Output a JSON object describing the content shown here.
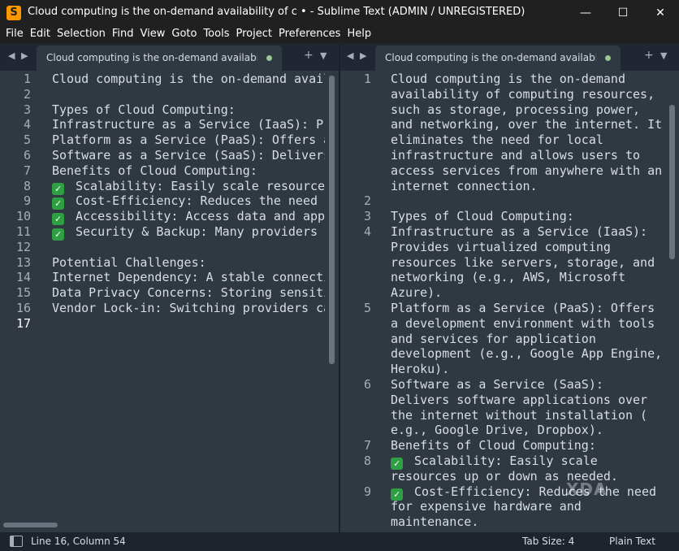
{
  "window": {
    "title": "Cloud computing is the on-demand availability of c • - Sublime Text (ADMIN / UNREGISTERED)",
    "minimize": "—",
    "maximize": "☐",
    "close": "✕"
  },
  "menu": [
    "File",
    "Edit",
    "Selection",
    "Find",
    "View",
    "Goto",
    "Tools",
    "Project",
    "Preferences",
    "Help"
  ],
  "left_pane": {
    "tab_label": "Cloud computing is the on-demand availability of c",
    "line_numbers": [
      "1",
      "2",
      "3",
      "4",
      "5",
      "6",
      "7",
      "8",
      "9",
      "10",
      "11",
      "12",
      "13",
      "14",
      "15",
      "16",
      "17"
    ],
    "lines": [
      "Cloud computing is the on-demand availab",
      "",
      "Types of Cloud Computing:",
      "Infrastructure as a Service (IaaS): Pro",
      "Platform as a Service (PaaS): Offers a",
      "Software as a Service (SaaS): Delivers",
      "Benefits of Cloud Computing:",
      "Scalability: Easily scale resources",
      "Cost-Efficiency: Reduces the need fo",
      "Accessibility: Access data and appli",
      "Security & Backup: Many providers of",
      "",
      "Potential Challenges:",
      "Internet Dependency: A stable connection",
      "Data Privacy Concerns: Storing sensitive",
      "Vendor Lock-in: Switching providers can",
      ""
    ]
  },
  "right_pane": {
    "tab_label": "Cloud computing is the on-demand availability of c",
    "line_numbers": [
      {
        "n": "1",
        "row": 0
      },
      {
        "n": "2",
        "row": 8
      },
      {
        "n": "3",
        "row": 9
      },
      {
        "n": "4",
        "row": 10
      },
      {
        "n": "5",
        "row": 15
      },
      {
        "n": "6",
        "row": 20
      },
      {
        "n": "7",
        "row": 24
      },
      {
        "n": "8",
        "row": 25
      },
      {
        "n": "9",
        "row": 27
      }
    ],
    "rows": [
      "Cloud computing is the on-demand",
      "availability of computing resources,",
      "such as storage, processing power,",
      "and networking, over the internet. It",
      "eliminates the need for local",
      "infrastructure and allows users to",
      "access services from anywhere with an",
      "internet connection.",
      "",
      "Types of Cloud Computing:",
      "Infrastructure as a Service (IaaS):",
      "Provides virtualized computing",
      "resources like servers, storage, and",
      "networking (e.g., AWS, Microsoft",
      "Azure).",
      "Platform as a Service (PaaS): Offers",
      "a development environment with tools",
      "and services for application",
      "development (e.g., Google App Engine,",
      "Heroku).",
      "Software as a Service (SaaS):",
      "Delivers software applications over",
      "the internet without installation (",
      "e.g., Google Drive, Dropbox).",
      "Benefits of Cloud Computing:",
      "Scalability: Easily scale",
      "resources up or down as needed.",
      "Cost-Efficiency: Reduces the need",
      "for expensive hardware and",
      "maintenance."
    ]
  },
  "status": {
    "position": "Line 16, Column 54",
    "tab_size": "Tab Size: 4",
    "syntax": "Plain Text"
  },
  "watermark": "XDA",
  "colors": {
    "background": "#303841",
    "check": "#2ea043",
    "modified_dot": "#99c794"
  }
}
